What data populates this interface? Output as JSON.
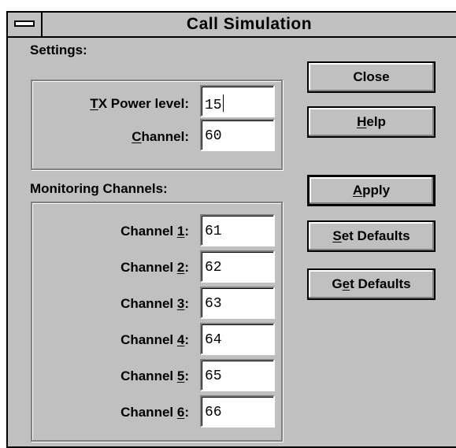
{
  "window": {
    "title": "Call Simulation"
  },
  "settings": {
    "group_label": "Settings:",
    "tx_power_label": "TX Power level:",
    "tx_power_mnemonic": "T",
    "tx_power_rest": "X Power level:",
    "tx_power_value": "15",
    "channel_label": "Channel:",
    "channel_mnemonic": "C",
    "channel_rest": "hannel:",
    "channel_value": "60"
  },
  "monitoring": {
    "group_label": "Monitoring Channels:",
    "channels": [
      {
        "label_prefix": "Channel ",
        "mnemonic": "1",
        "suffix": ":",
        "value": "61"
      },
      {
        "label_prefix": "Channel ",
        "mnemonic": "2",
        "suffix": ":",
        "value": "62"
      },
      {
        "label_prefix": "Channel ",
        "mnemonic": "3",
        "suffix": ":",
        "value": "63"
      },
      {
        "label_prefix": "Channel ",
        "mnemonic": "4",
        "suffix": ":",
        "value": "64"
      },
      {
        "label_prefix": "Channel ",
        "mnemonic": "5",
        "suffix": ":",
        "value": "65"
      },
      {
        "label_prefix": "Channel ",
        "mnemonic": "6",
        "suffix": ":",
        "value": "66"
      }
    ]
  },
  "buttons": {
    "close": {
      "label": "Close"
    },
    "help": {
      "mnemonic": "H",
      "rest": "elp"
    },
    "apply": {
      "mnemonic": "A",
      "rest": "pply"
    },
    "set_defaults": {
      "mnemonic": "S",
      "rest": "et Defaults"
    },
    "get_defaults": {
      "prefix": "G",
      "mnemonic": "e",
      "rest": "t Defaults"
    }
  },
  "icons": {
    "system_menu": "system-menu-icon"
  }
}
